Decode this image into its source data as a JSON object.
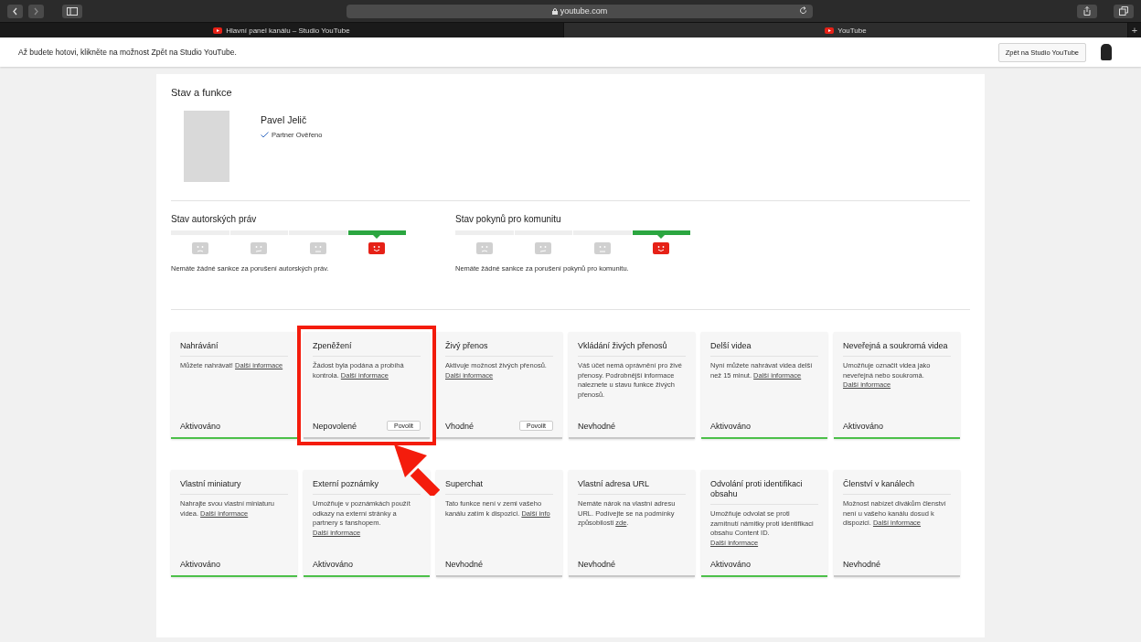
{
  "browser": {
    "address": "youtube.com",
    "tabs": [
      {
        "title": "Hlavní panel kanálu – Studio YouTube",
        "selected": false
      },
      {
        "title": "YouTube",
        "selected": true
      }
    ],
    "new_tab": "+"
  },
  "notice": {
    "text": "Až budete hotovi, klikněte na možnost Zpět na Studio YouTube.",
    "button": "Zpět na Studio YouTube"
  },
  "panel": {
    "title": "Stav a funkce",
    "channel": {
      "name": "Pavel Jelič",
      "badge": "Partner Ověřeno"
    }
  },
  "standings": [
    {
      "title": "Stav autorských práv",
      "faces": [
        {
          "selected": false
        },
        {
          "selected": false
        },
        {
          "selected": false
        },
        {
          "selected": true
        }
      ],
      "message": "Nemáte žádné sankce za porušení autorských práv."
    },
    {
      "title": "Stav pokynů pro komunitu",
      "faces": [
        {
          "selected": false
        },
        {
          "selected": false
        },
        {
          "selected": false
        },
        {
          "selected": true
        }
      ],
      "message": "Nemáte žádné sankce za porušení pokynů pro komunitu."
    }
  ],
  "features": [
    {
      "title": "Nahrávání",
      "text": "Můžete nahrávat! ",
      "link": "Další informace",
      "status": "Aktivováno",
      "active": true,
      "highlighted": false
    },
    {
      "title": "Zpeněžení",
      "text": "Žádost byla podána a probíhá kontrola. ",
      "link": "Další informace",
      "status": "Nepovolené",
      "button": "Povolit",
      "active": false,
      "highlighted": true
    },
    {
      "title": "Živý přenos",
      "text": "Aktivuje možnost živých přenosů. ",
      "link": "Další informace",
      "status": "Vhodné",
      "button": "Povolit",
      "active": false,
      "highlighted": false
    },
    {
      "title": "Vkládání živých přenosů",
      "text": "Váš účet nemá oprávnění pro živé přenosy. Podrobnější informace naleznete u stavu funkce živých přenosů.",
      "status": "Nevhodné",
      "active": false,
      "highlighted": false
    },
    {
      "title": "Delší videa",
      "text": "Nyní můžete nahrávat videa delší než 15 minut. ",
      "link": "Další informace",
      "status": "Aktivováno",
      "active": true,
      "highlighted": false
    },
    {
      "title": "Neveřejná a soukromá videa",
      "text": "Umožňuje označit videa jako neveřejná nebo soukromá. ",
      "link": "Další informace",
      "status": "Aktivováno",
      "active": true,
      "highlighted": false
    },
    {
      "title": "Vlastní miniatury",
      "text": "Nahrajte svou vlastní miniaturu videa. ",
      "link": "Další informace",
      "status": "Aktivováno",
      "active": true,
      "highlighted": false
    },
    {
      "title": "Externí poznámky",
      "text": "Umožňuje v poznámkách použít odkazy na externí stránky a partnery s fanshopem. ",
      "link": "Další informace",
      "status": "Aktivováno",
      "active": true,
      "highlighted": false
    },
    {
      "title": "Superchat",
      "text": "Tato funkce není v zemi vašeho kanálu zatím k dispozici. ",
      "link": "Další info",
      "status": "Nevhodné",
      "active": false,
      "highlighted": false
    },
    {
      "title": "Vlastní adresa URL",
      "text": "Nemáte nárok na vlastní adresu URL. Podívejte se na podmínky způsobilosti ",
      "link": "zde",
      "after": ".",
      "status": "Nevhodné",
      "active": false,
      "highlighted": false
    },
    {
      "title": "Odvolání proti identifikaci obsahu",
      "text": "Umožňuje odvolat se proti zamítnutí námitky proti identifikaci obsahu Content ID. ",
      "link": "Další informace",
      "status": "Aktivováno",
      "active": true,
      "highlighted": false
    },
    {
      "title": "Členství v kanálech",
      "text": "Možnost nabízet divákům členství není u vašeho kanálu dosud k dispozici. ",
      "link": "Další informace",
      "status": "Nevhodné",
      "active": false,
      "highlighted": false
    }
  ]
}
